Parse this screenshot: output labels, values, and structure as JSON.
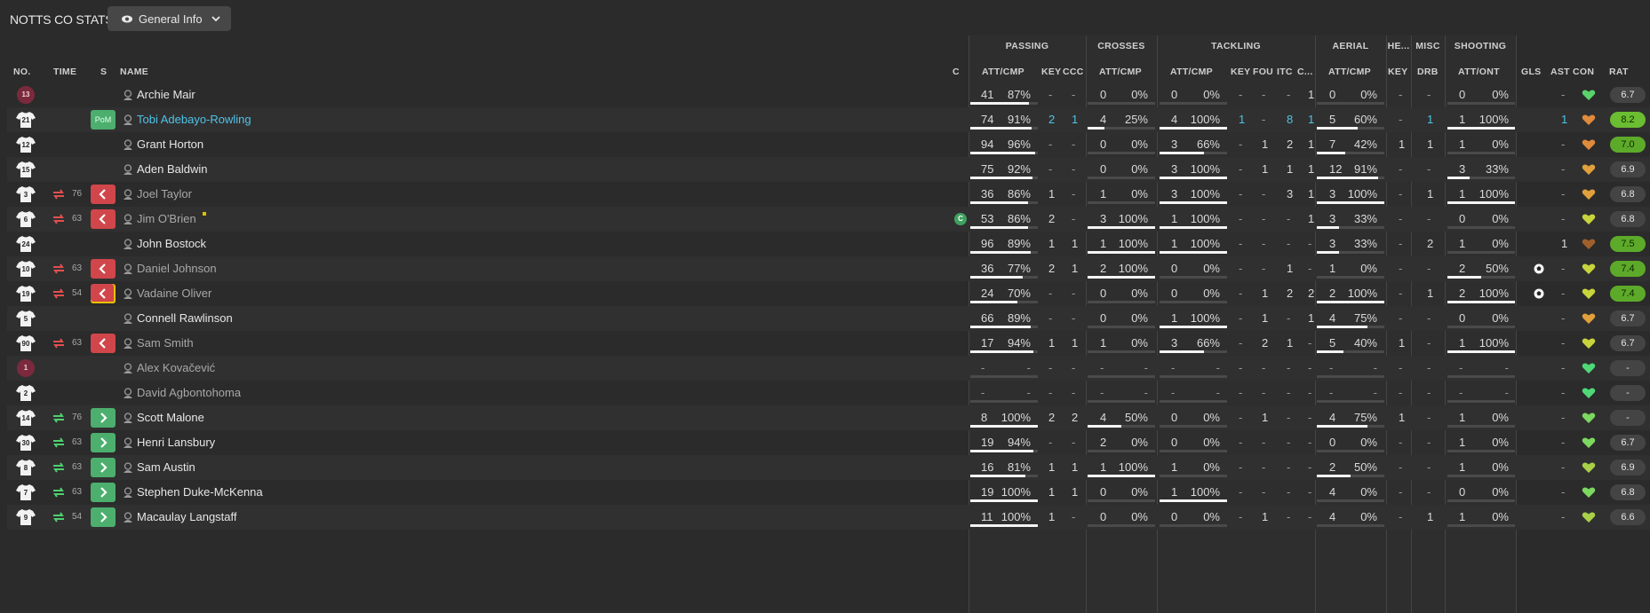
{
  "title": "NOTTS CO STATS",
  "view": {
    "label": "General Info",
    "icon": "eye-icon"
  },
  "groups": {
    "passing": "PASSING",
    "crosses": "CROSSES",
    "tackling": "TACKLING",
    "aerial": "AERIAL",
    "headers": "HE...",
    "misc": "MISC",
    "shooting": "SHOOTING"
  },
  "columns": {
    "no": "NO.",
    "time": "TIME",
    "s": "S",
    "name": "NAME",
    "c": "C",
    "pass_att_cmp": "ATT/CMP",
    "pass_key": "KEY",
    "pass_ccc": "CCC",
    "cross_att_cmp": "ATT/CMP",
    "tack_att_cmp": "ATT/CMP",
    "tack_key": "KEY",
    "tack_fou": "FOU",
    "tack_itc": "ITC",
    "tack_c": "C...",
    "aer_att_cmp": "ATT/CMP",
    "he_key": "KEY",
    "misc_drb": "DRB",
    "shot_att_ont": "ATT/ONT",
    "gls": "GLS",
    "ast": "AST",
    "con": "CON",
    "rat": "RAT"
  },
  "colors": {
    "accent_cyan": "#4fc3e8",
    "sub_off": "#d0464a",
    "sub_on": "#4caf6e",
    "rating_good": "#5daa2a"
  },
  "players": [
    {
      "no": "13",
      "gk": true,
      "time": "",
      "status": "",
      "name": "Archie Mair",
      "pa": "41",
      "pp": "87%",
      "pf": 0.87,
      "pk": "-",
      "pc": "-",
      "ca": "0",
      "cp": "0%",
      "cf": 0,
      "ta": "0",
      "tp": "0%",
      "tf": 0,
      "tk": "-",
      "tfo": "-",
      "ti": "-",
      "tc": "1",
      "aa": "0",
      "ap": "0%",
      "af": 0,
      "hk": "-",
      "drb": "-",
      "sa": "0",
      "sp": "0%",
      "sf": 0,
      "gls": "",
      "ast": "-",
      "rat": "6.7",
      "ratc": "",
      "heart": "#5ad36a"
    },
    {
      "no": "21",
      "gk": false,
      "time": "",
      "status": "pom",
      "name": "Tobi Adebayo-Rowling",
      "pa": "74",
      "pp": "91%",
      "pf": 0.91,
      "pk": "2",
      "pc": "1",
      "ca": "4",
      "cp": "25%",
      "cf": 0.25,
      "ta": "4",
      "tp": "100%",
      "tf": 1,
      "tk": "1",
      "tfo": "-",
      "ti": "8",
      "tc": "1",
      "aa": "5",
      "ap": "60%",
      "af": 0.6,
      "hk": "-",
      "drb": "1",
      "sa": "1",
      "sp": "100%",
      "sf": 1,
      "gls": "",
      "ast": "1",
      "rat": "8.2",
      "ratc": "good2",
      "heart": "#e08a3c"
    },
    {
      "no": "12",
      "gk": false,
      "time": "",
      "status": "",
      "name": "Grant Horton",
      "pa": "94",
      "pp": "96%",
      "pf": 0.96,
      "pk": "-",
      "pc": "-",
      "ca": "0",
      "cp": "0%",
      "cf": 0,
      "ta": "3",
      "tp": "66%",
      "tf": 0.66,
      "tk": "-",
      "tfo": "1",
      "ti": "2",
      "tc": "1",
      "aa": "7",
      "ap": "42%",
      "af": 0.42,
      "hk": "1",
      "drb": "1",
      "sa": "1",
      "sp": "0%",
      "sf": 0,
      "gls": "",
      "ast": "-",
      "rat": "7.0",
      "ratc": "good",
      "heart": "#e08a3c"
    },
    {
      "no": "15",
      "gk": false,
      "time": "",
      "status": "",
      "name": "Aden Baldwin",
      "pa": "75",
      "pp": "92%",
      "pf": 0.92,
      "pk": "-",
      "pc": "-",
      "ca": "0",
      "cp": "0%",
      "cf": 0,
      "ta": "3",
      "tp": "100%",
      "tf": 1,
      "tk": "-",
      "tfo": "1",
      "ti": "1",
      "tc": "1",
      "aa": "12",
      "ap": "91%",
      "af": 0.91,
      "hk": "-",
      "drb": "-",
      "sa": "3",
      "sp": "33%",
      "sf": 0.33,
      "gls": "",
      "ast": "-",
      "rat": "6.9",
      "ratc": "",
      "heart": "#e0a03c"
    },
    {
      "no": "3",
      "gk": false,
      "time": "76",
      "status": "off",
      "name": "Joel Taylor",
      "pa": "36",
      "pp": "86%",
      "pf": 0.86,
      "pk": "1",
      "pc": "-",
      "ca": "1",
      "cp": "0%",
      "cf": 0,
      "ta": "3",
      "tp": "100%",
      "tf": 1,
      "tk": "-",
      "tfo": "-",
      "ti": "3",
      "tc": "1",
      "aa": "3",
      "ap": "100%",
      "af": 1,
      "hk": "-",
      "drb": "1",
      "sa": "1",
      "sp": "100%",
      "sf": 1,
      "gls": "",
      "ast": "-",
      "rat": "6.8",
      "ratc": "",
      "heart": "#e0a03c"
    },
    {
      "no": "6",
      "gk": false,
      "time": "63",
      "status": "off",
      "name": "Jim O'Brien",
      "pa": "53",
      "pp": "86%",
      "pf": 0.86,
      "pk": "2",
      "pc": "-",
      "ca": "3",
      "cp": "100%",
      "cf": 1,
      "ta": "1",
      "tp": "100%",
      "tf": 1,
      "tk": "-",
      "tfo": "-",
      "ti": "-",
      "tc": "1",
      "aa": "3",
      "ap": "33%",
      "af": 0.33,
      "hk": "-",
      "drb": "-",
      "sa": "0",
      "sp": "0%",
      "sf": 0,
      "gls": "",
      "ast": "-",
      "rat": "6.8",
      "ratc": "",
      "heart": "#c8d43c",
      "captain": true
    },
    {
      "no": "24",
      "gk": false,
      "time": "",
      "status": "",
      "name": "John Bostock",
      "pa": "96",
      "pp": "89%",
      "pf": 0.89,
      "pk": "1",
      "pc": "1",
      "ca": "1",
      "cp": "100%",
      "cf": 1,
      "ta": "1",
      "tp": "100%",
      "tf": 1,
      "tk": "-",
      "tfo": "-",
      "ti": "-",
      "tc": "-",
      "aa": "3",
      "ap": "33%",
      "af": 0.33,
      "hk": "-",
      "drb": "2",
      "sa": "1",
      "sp": "0%",
      "sf": 0,
      "gls": "",
      "ast": "1",
      "rat": "7.5",
      "ratc": "good",
      "heart": "#a0602c"
    },
    {
      "no": "10",
      "gk": false,
      "time": "63",
      "status": "off",
      "name": "Daniel Johnson",
      "pa": "36",
      "pp": "77%",
      "pf": 0.77,
      "pk": "2",
      "pc": "1",
      "ca": "2",
      "cp": "100%",
      "cf": 1,
      "ta": "0",
      "tp": "0%",
      "tf": 0,
      "tk": "-",
      "tfo": "-",
      "ti": "1",
      "tc": "-",
      "aa": "1",
      "ap": "0%",
      "af": 0,
      "hk": "-",
      "drb": "-",
      "sa": "2",
      "sp": "50%",
      "sf": 0.5,
      "gls": "ball",
      "ast": "-",
      "rat": "7.4",
      "ratc": "good",
      "heart": "#c8d43c"
    },
    {
      "no": "19",
      "gk": false,
      "time": "54",
      "status": "off",
      "name": "Vadaine Oliver",
      "pa": "24",
      "pp": "70%",
      "pf": 0.7,
      "pk": "-",
      "pc": "-",
      "ca": "0",
      "cp": "0%",
      "cf": 0,
      "ta": "0",
      "tp": "0%",
      "tf": 0,
      "tk": "-",
      "tfo": "1",
      "ti": "2",
      "tc": "2",
      "aa": "2",
      "ap": "100%",
      "af": 1,
      "hk": "-",
      "drb": "1",
      "sa": "2",
      "sp": "100%",
      "sf": 1,
      "gls": "ball",
      "ast": "-",
      "rat": "7.4",
      "ratc": "good",
      "heart": "#c8d43c"
    },
    {
      "no": "5",
      "gk": false,
      "time": "",
      "status": "",
      "name": "Connell Rawlinson",
      "pa": "66",
      "pp": "89%",
      "pf": 0.89,
      "pk": "-",
      "pc": "-",
      "ca": "0",
      "cp": "0%",
      "cf": 0,
      "ta": "1",
      "tp": "100%",
      "tf": 1,
      "tk": "-",
      "tfo": "1",
      "ti": "-",
      "tc": "1",
      "aa": "4",
      "ap": "75%",
      "af": 0.75,
      "hk": "-",
      "drb": "-",
      "sa": "0",
      "sp": "0%",
      "sf": 0,
      "gls": "",
      "ast": "-",
      "rat": "6.7",
      "ratc": "",
      "heart": "#e0a03c"
    },
    {
      "no": "90",
      "gk": false,
      "time": "63",
      "status": "off",
      "name": "Sam Smith",
      "pa": "17",
      "pp": "94%",
      "pf": 0.94,
      "pk": "1",
      "pc": "1",
      "ca": "1",
      "cp": "0%",
      "cf": 0,
      "ta": "3",
      "tp": "66%",
      "tf": 0.66,
      "tk": "-",
      "tfo": "2",
      "ti": "1",
      "tc": "-",
      "aa": "5",
      "ap": "40%",
      "af": 0.4,
      "hk": "1",
      "drb": "-",
      "sa": "1",
      "sp": "100%",
      "sf": 1,
      "gls": "",
      "ast": "-",
      "rat": "6.7",
      "ratc": "",
      "heart": "#c8d43c"
    },
    {
      "no": "1",
      "gk": true,
      "time": "",
      "status": "",
      "name": "Alex Kovačević",
      "pa": "-",
      "pp": "-",
      "pf": 0,
      "pk": "-",
      "pc": "-",
      "ca": "-",
      "cp": "-",
      "cf": 0,
      "ta": "-",
      "tp": "-",
      "tf": 0,
      "tk": "-",
      "tfo": "-",
      "ti": "-",
      "tc": "-",
      "aa": "-",
      "ap": "-",
      "af": 0,
      "hk": "-",
      "drb": "-",
      "sa": "-",
      "sp": "-",
      "sf": 0,
      "gls": "",
      "ast": "-",
      "rat": "-",
      "ratc": "",
      "heart": "#4fd878",
      "unused": true
    },
    {
      "no": "2",
      "gk": false,
      "time": "",
      "status": "",
      "name": "David Agbontohoma",
      "pa": "-",
      "pp": "-",
      "pf": 0,
      "pk": "-",
      "pc": "-",
      "ca": "-",
      "cp": "-",
      "cf": 0,
      "ta": "-",
      "tp": "-",
      "tf": 0,
      "tk": "-",
      "tfo": "-",
      "ti": "-",
      "tc": "-",
      "aa": "-",
      "ap": "-",
      "af": 0,
      "hk": "-",
      "drb": "-",
      "sa": "-",
      "sp": "-",
      "sf": 0,
      "gls": "",
      "ast": "-",
      "rat": "-",
      "ratc": "",
      "heart": "#4fd878",
      "unused": true
    },
    {
      "no": "14",
      "gk": false,
      "time": "76",
      "status": "on",
      "name": "Scott Malone",
      "pa": "8",
      "pp": "100%",
      "pf": 1,
      "pk": "2",
      "pc": "2",
      "ca": "4",
      "cp": "50%",
      "cf": 0.5,
      "ta": "0",
      "tp": "0%",
      "tf": 0,
      "tk": "-",
      "tfo": "1",
      "ti": "-",
      "tc": "-",
      "aa": "4",
      "ap": "75%",
      "af": 0.75,
      "hk": "1",
      "drb": "-",
      "sa": "1",
      "sp": "0%",
      "sf": 0,
      "gls": "",
      "ast": "-",
      "rat": "-",
      "ratc": "",
      "heart": "#7cd860"
    },
    {
      "no": "30",
      "gk": false,
      "time": "63",
      "status": "on",
      "name": "Henri Lansbury",
      "pa": "19",
      "pp": "94%",
      "pf": 0.94,
      "pk": "-",
      "pc": "-",
      "ca": "2",
      "cp": "0%",
      "cf": 0,
      "ta": "0",
      "tp": "0%",
      "tf": 0,
      "tk": "-",
      "tfo": "-",
      "ti": "-",
      "tc": "-",
      "aa": "0",
      "ap": "0%",
      "af": 0,
      "hk": "-",
      "drb": "-",
      "sa": "1",
      "sp": "0%",
      "sf": 0,
      "gls": "",
      "ast": "-",
      "rat": "6.7",
      "ratc": "",
      "heart": "#7cd860"
    },
    {
      "no": "8",
      "gk": false,
      "time": "63",
      "status": "on",
      "name": "Sam Austin",
      "pa": "16",
      "pp": "81%",
      "pf": 0.81,
      "pk": "1",
      "pc": "1",
      "ca": "1",
      "cp": "100%",
      "cf": 1,
      "ta": "1",
      "tp": "0%",
      "tf": 0,
      "tk": "-",
      "tfo": "-",
      "ti": "-",
      "tc": "-",
      "aa": "2",
      "ap": "50%",
      "af": 0.5,
      "hk": "-",
      "drb": "-",
      "sa": "1",
      "sp": "0%",
      "sf": 0,
      "gls": "",
      "ast": "-",
      "rat": "6.9",
      "ratc": "",
      "heart": "#a8d048"
    },
    {
      "no": "7",
      "gk": false,
      "time": "63",
      "status": "on",
      "name": "Stephen Duke-McKenna",
      "pa": "19",
      "pp": "100%",
      "pf": 1,
      "pk": "1",
      "pc": "1",
      "ca": "0",
      "cp": "0%",
      "cf": 0,
      "ta": "1",
      "tp": "100%",
      "tf": 1,
      "tk": "-",
      "tfo": "-",
      "ti": "-",
      "tc": "-",
      "aa": "4",
      "ap": "0%",
      "af": 0,
      "hk": "-",
      "drb": "-",
      "sa": "0",
      "sp": "0%",
      "sf": 0,
      "gls": "",
      "ast": "-",
      "rat": "6.8",
      "ratc": "",
      "heart": "#7cd860"
    },
    {
      "no": "9",
      "gk": false,
      "time": "54",
      "status": "on",
      "name": "Macaulay Langstaff",
      "pa": "11",
      "pp": "100%",
      "pf": 1,
      "pk": "1",
      "pc": "-",
      "ca": "0",
      "cp": "0%",
      "cf": 0,
      "ta": "0",
      "tp": "0%",
      "tf": 0,
      "tk": "-",
      "tfo": "1",
      "ti": "-",
      "tc": "-",
      "aa": "4",
      "ap": "0%",
      "af": 0,
      "hk": "-",
      "drb": "1",
      "sa": "1",
      "sp": "0%",
      "sf": 0,
      "gls": "",
      "ast": "-",
      "rat": "6.6",
      "ratc": "",
      "heart": "#a8d048"
    }
  ]
}
